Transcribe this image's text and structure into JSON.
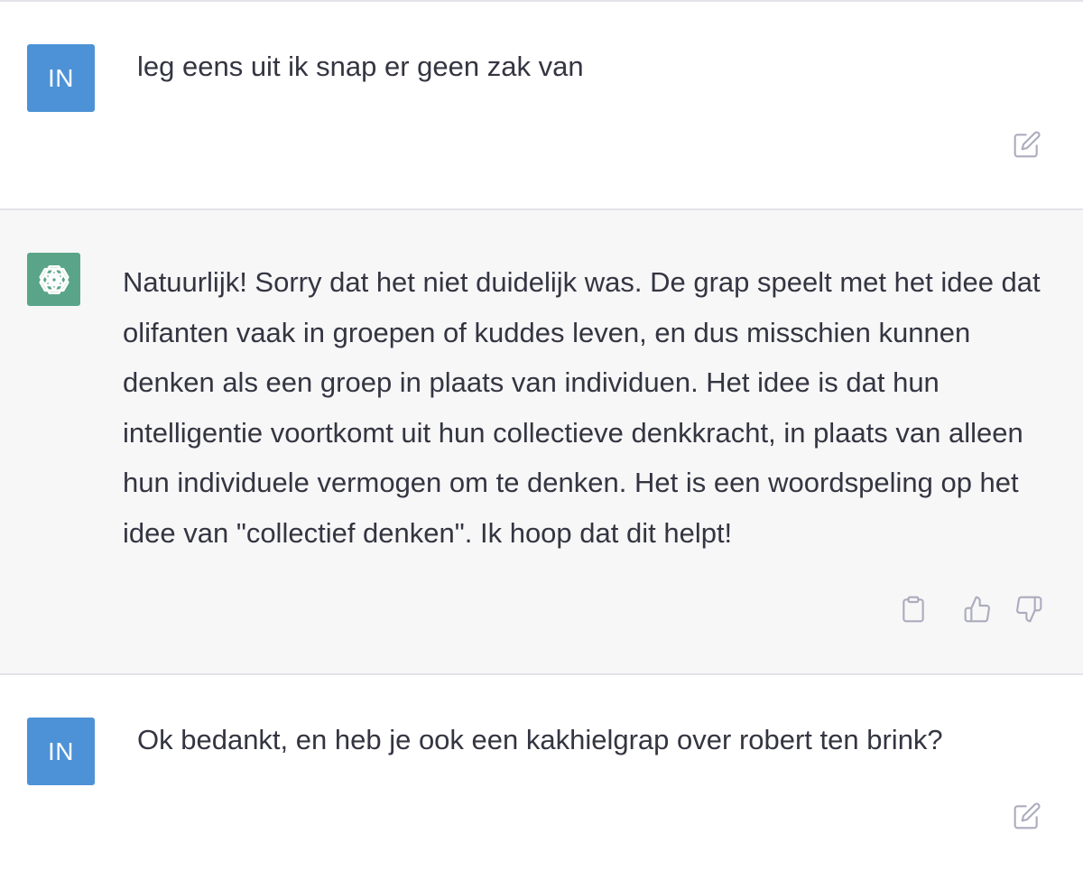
{
  "conversation": {
    "messages": [
      {
        "role": "user",
        "avatar_initials": "IN",
        "text": "leg eens uit ik snap er geen zak van",
        "actions": [
          "edit-icon"
        ]
      },
      {
        "role": "assistant",
        "avatar_icon": "openai-logo-icon",
        "text": "Natuurlijk! Sorry dat het niet duidelijk was. De grap speelt met het idee dat olifanten vaak in groepen of kuddes leven, en dus misschien kunnen denken als een groep in plaats van individuen. Het idee is dat hun intelligentie voortkomt uit hun collectieve denkkracht, in plaats van alleen hun individuele vermogen om te denken. Het is een woordspeling op het idee van \"collectief denken\". Ik hoop dat dit helpt!",
        "actions": [
          "clipboard-icon",
          "thumbs-up-icon",
          "thumbs-down-icon"
        ]
      },
      {
        "role": "user",
        "avatar_initials": "IN",
        "text": "Ok bedankt, en heb je ook een kakhielgrap over robert ten brink?",
        "actions": [
          "edit-icon"
        ]
      }
    ]
  },
  "colors": {
    "user_avatar": "#4d92d6",
    "assistant_avatar": "#5aa589",
    "assistant_background": "#f7f7f8",
    "text": "#343541",
    "icon": "#acacbe"
  }
}
